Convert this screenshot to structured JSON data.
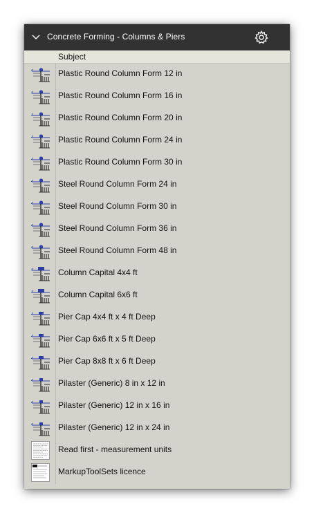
{
  "panel": {
    "title": "Concrete Forming - Columns & Piers",
    "column_header": "Subject",
    "items": [
      {
        "label": "Plastic Round Column Form 12 in",
        "icon": "column-form-icon"
      },
      {
        "label": "Plastic Round Column Form 16 in",
        "icon": "column-form-icon"
      },
      {
        "label": "Plastic Round Column Form 20 in",
        "icon": "column-form-icon"
      },
      {
        "label": "Plastic Round Column Form 24 in",
        "icon": "column-form-icon"
      },
      {
        "label": "Plastic Round Column Form 30 in",
        "icon": "column-form-icon"
      },
      {
        "label": "Steel Round Column Form 24 in",
        "icon": "column-form-icon"
      },
      {
        "label": "Steel Round Column Form 30 in",
        "icon": "column-form-icon"
      },
      {
        "label": "Steel Round Column Form 36 in",
        "icon": "column-form-icon"
      },
      {
        "label": "Steel Round Column Form 48 in",
        "icon": "column-form-icon"
      },
      {
        "label": "Column Capital 4x4 ft",
        "icon": "column-capital-icon"
      },
      {
        "label": "Column Capital 6x6 ft",
        "icon": "column-capital-icon"
      },
      {
        "label": "Pier Cap 4x4 ft x 4 ft Deep",
        "icon": "pier-cap-icon"
      },
      {
        "label": "Pier Cap 6x6 ft x 5 ft Deep",
        "icon": "pier-cap-icon"
      },
      {
        "label": "Pier Cap 8x8 ft x 6 ft Deep",
        "icon": "pier-cap-icon"
      },
      {
        "label": "Pilaster (Generic) 8 in x 12 in",
        "icon": "pilaster-icon"
      },
      {
        "label": "Pilaster (Generic) 12 in x 16 in",
        "icon": "pilaster-icon"
      },
      {
        "label": "Pilaster (Generic) 12 in x 24 in",
        "icon": "pilaster-icon"
      },
      {
        "label": "Read first - measurement units",
        "icon": "document-icon"
      },
      {
        "label": "MarkupToolSets licence",
        "icon": "licence-document-icon"
      }
    ]
  },
  "colors": {
    "header_bg": "#323232",
    "panel_bg": "#d4d3cb",
    "icon_blue": "#2b3ea8"
  }
}
